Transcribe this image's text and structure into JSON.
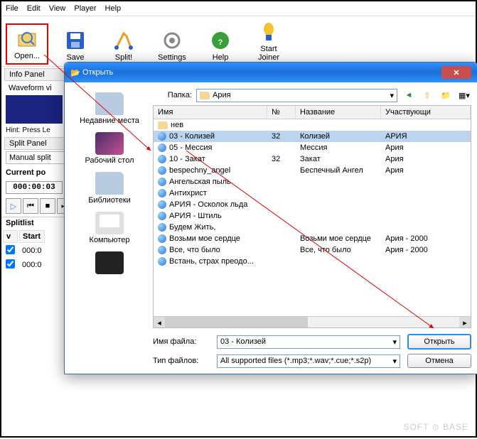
{
  "menu": {
    "file": "File",
    "edit": "Edit",
    "view": "View",
    "player": "Player",
    "help": "Help"
  },
  "toolbar": {
    "open": "Open...",
    "save": "Save",
    "split": "Split!",
    "settings": "Settings",
    "help": "Help",
    "joiner": "Start Joiner"
  },
  "panels": {
    "info": "Info Panel",
    "waveform": "Waveform vi",
    "hint": "Hint: Press Le",
    "split": "Split Panel",
    "manual": "Manual split",
    "curpos": "Current po",
    "time": "000:00:03",
    "splitlist": "Splitlist"
  },
  "splitlist": {
    "cols": {
      "v": "v",
      "start": "Start"
    },
    "rows": [
      {
        "v": true,
        "start": "000:0"
      },
      {
        "v": true,
        "start": "000:0"
      }
    ]
  },
  "dialog": {
    "title": "Открыть",
    "folder_label": "Папка:",
    "folder_value": "Ария",
    "cols": {
      "name": "Имя",
      "num": "№",
      "title": "Название",
      "artist": "Участвующи"
    },
    "files": [
      {
        "type": "folder",
        "name": "нев",
        "num": "",
        "title": "",
        "artist": ""
      },
      {
        "type": "file",
        "name": "03 - Колизей",
        "num": "32",
        "title": "Колизей",
        "artist": "АРИЯ",
        "sel": true
      },
      {
        "type": "file",
        "name": "05 - Мессия",
        "num": "",
        "title": "Мессия",
        "artist": "Ария"
      },
      {
        "type": "file",
        "name": "10 - Закат",
        "num": "32",
        "title": "Закат",
        "artist": "Ария"
      },
      {
        "type": "file",
        "name": "bespechny_angel",
        "num": "",
        "title": "Беспечный Ангел",
        "artist": "Ария"
      },
      {
        "type": "file",
        "name": "Ангельская пыль",
        "num": "",
        "title": "",
        "artist": ""
      },
      {
        "type": "file",
        "name": "Антихрист",
        "num": "",
        "title": "",
        "artist": ""
      },
      {
        "type": "file",
        "name": "АРИЯ - Осколок льда",
        "num": "",
        "title": "",
        "artist": ""
      },
      {
        "type": "file",
        "name": "АРИЯ - Штиль",
        "num": "",
        "title": "",
        "artist": ""
      },
      {
        "type": "file",
        "name": "Будем Жить,",
        "num": "",
        "title": "",
        "artist": ""
      },
      {
        "type": "file",
        "name": "Возьми мое сердце",
        "num": "",
        "title": "Возьми мое сердце",
        "artist": "Ария - 2000"
      },
      {
        "type": "file",
        "name": "Все, что было",
        "num": "",
        "title": "Все, что было",
        "artist": "Ария - 2000"
      },
      {
        "type": "file",
        "name": "Встань, страх преодо...",
        "num": "",
        "title": "",
        "artist": ""
      }
    ],
    "sidebar": [
      {
        "label": "Недавние места",
        "cls": "folder"
      },
      {
        "label": "Рабочий стол",
        "cls": "desktop"
      },
      {
        "label": "Библиотеки",
        "cls": "folder"
      },
      {
        "label": "Компьютер",
        "cls": "comp"
      },
      {
        "label": "",
        "cls": "net"
      }
    ],
    "filename_label": "Имя файла:",
    "filename_value": "03 - Колизей",
    "filetype_label": "Тип файлов:",
    "filetype_value": "All supported files (*.mp3;*.wav;*.cue;*.s2p)",
    "open_btn": "Открыть",
    "cancel_btn": "Отмена"
  },
  "watermark": "SOFT ⊙ BASE"
}
